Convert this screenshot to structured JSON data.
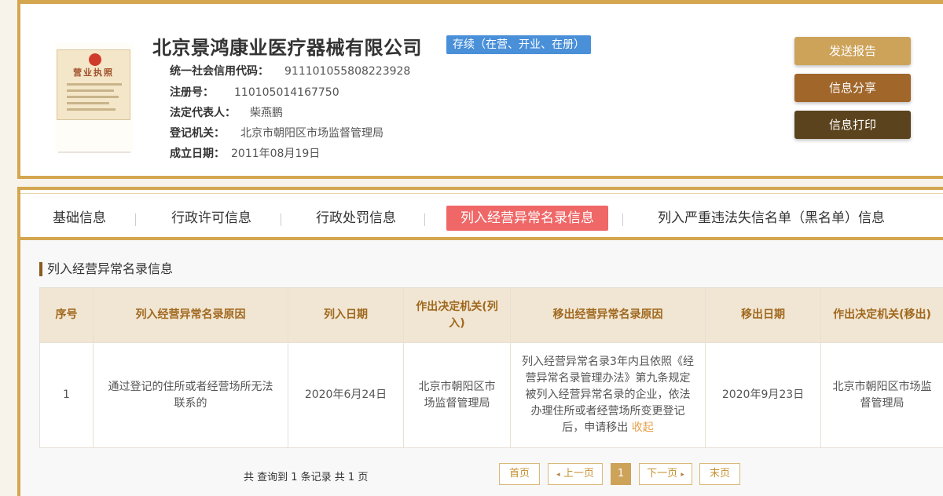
{
  "company": {
    "name": "北京景鸿康业医疗器械有限公司",
    "status": "存续（在营、开业、在册）",
    "license_image_title": "营业执照"
  },
  "info": [
    {
      "label": "统一社会信用代码：",
      "value": "911101055808223928"
    },
    {
      "label": "注册号：",
      "value": "110105014167750"
    },
    {
      "label": "法定代表人：",
      "value": "柴燕鹏"
    },
    {
      "label": "登记机关：",
      "value": "北京市朝阳区市场监督管理局"
    },
    {
      "label": "成立日期：",
      "value": "2011年08月19日"
    }
  ],
  "actions": {
    "report": "发送报告",
    "share": "信息分享",
    "print": "信息打印"
  },
  "tabs": [
    {
      "label": "基础信息"
    },
    {
      "label": "行政许可信息"
    },
    {
      "label": "行政处罚信息"
    },
    {
      "label": "列入经营异常名录信息",
      "active": true
    },
    {
      "label": "列入严重违法失信名单（黑名单）信息"
    }
  ],
  "section": {
    "title": "列入经营异常名录信息"
  },
  "table": {
    "headers": [
      "序号",
      "列入经营异常名录原因",
      "列入日期",
      "作出决定机关(列入)",
      "移出经营异常名录原因",
      "移出日期",
      "作出决定机关(移出)"
    ],
    "rows": [
      {
        "index": "1",
        "reason_in": "通过登记的住所或者经营场所无法联系的",
        "date_in": "2020年6月24日",
        "authority_in": "北京市朝阳区市场监督管理局",
        "reason_out": "列入经营异常名录3年内且依照《经营异常名录管理办法》第九条规定被列入经营异常名录的企业，依法办理住所或者经营场所变更登记后，申请移出",
        "reason_out_toggle": "收起",
        "date_out": "2020年9月23日",
        "authority_out": "北京市朝阳区市场监督管理局"
      }
    ]
  },
  "pager": {
    "summary": "共 查询到 1 条记录 共 1 页",
    "first": "首页",
    "prev": "上一页",
    "current": "1",
    "next": "下一页",
    "last": "末页"
  },
  "colors": {
    "gold_border": "#d3a64f",
    "status_badge": "#4a90d9",
    "active_tab": "#ef6767",
    "btn_report": "#cda259",
    "btn_share": "#a0662a",
    "btn_print": "#5b431d",
    "table_header_bg": "#f1e6d3",
    "table_header_text": "#a0681e"
  }
}
